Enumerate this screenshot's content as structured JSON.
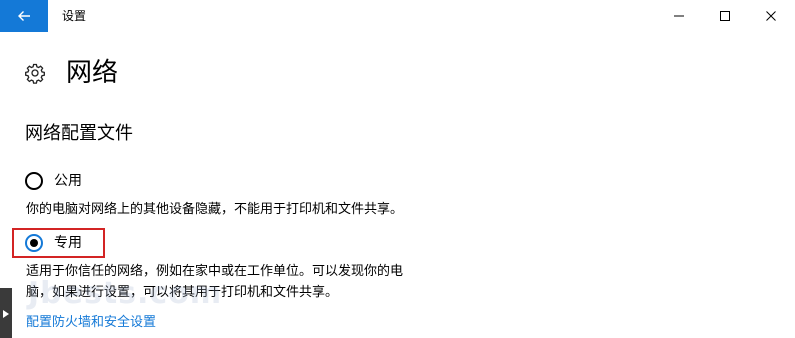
{
  "titlebar": {
    "back_icon": "back-arrow-icon",
    "title": "设置",
    "controls": {
      "minimize_icon": "minimize-icon",
      "maximize_icon": "maximize-icon",
      "close_icon": "close-icon"
    }
  },
  "page": {
    "icon": "gear-icon",
    "title": "网络"
  },
  "section": {
    "title": "网络配置文件",
    "options": [
      {
        "label": "公用",
        "selected": false,
        "description": "你的电脑对网络上的其他设备隐藏，不能用于打印机和文件共享。"
      },
      {
        "label": "专用",
        "selected": true,
        "description_line1": "适用于你信任的网络，例如在家中或在工作单位。可以发现你的电",
        "description_line2": "脑，如果进行设置，可以将其用于打印机和文件共享。"
      }
    ]
  },
  "link": {
    "firewall": "配置防火墙和安全设置"
  },
  "watermark": "Jbests.com",
  "colors": {
    "accent": "#1479d7",
    "highlight_border": "#d32424",
    "background": "#ffffff"
  }
}
